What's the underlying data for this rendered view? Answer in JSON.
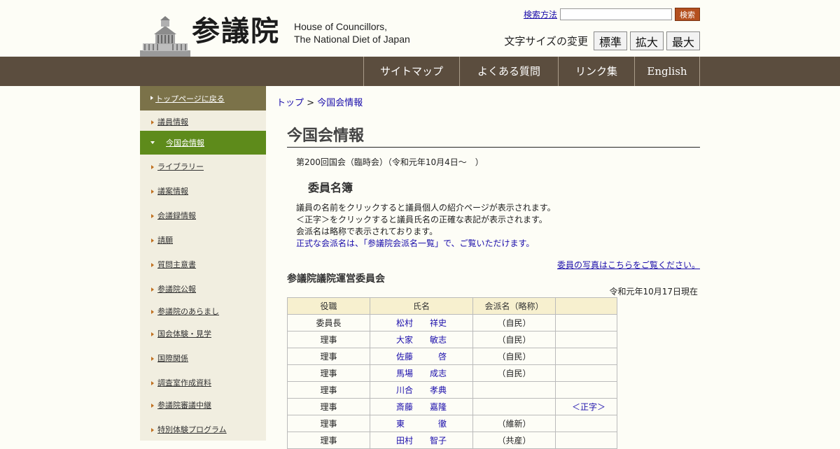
{
  "header": {
    "logo_kanji": "参議院",
    "logo_en_line1": "House of Councillors,",
    "logo_en_line2": "The National Diet of Japan",
    "search_link": "検索方法",
    "search_value": "",
    "search_button": "検索",
    "fontsize_label": "文字サイズの変更",
    "fontsize_buttons": [
      "標準",
      "拡大",
      "最大"
    ]
  },
  "nav": [
    "サイトマップ",
    "よくある質問",
    "リンク集",
    "English"
  ],
  "sidebar": {
    "top": "トップページに戻る",
    "items": [
      "議員情報",
      "今国会情報",
      "ライブラリー",
      "議案情報",
      "会議録情報",
      "請願",
      "質問主意書",
      "参議院公報",
      "参議院のあらまし",
      "国会体験・見学",
      "国際関係",
      "調査室作成資料",
      "参議院審議中継",
      "特別体験プログラム"
    ]
  },
  "breadcrumb": {
    "top": "トップ",
    "sep": " > ",
    "current": "今国会情報"
  },
  "page_title": "今国会情報",
  "session": "第200回国会（臨時会）（令和元年10月4日～　）",
  "subhead": "委員名簿",
  "notes": [
    "議員の名前をクリックすると議員個人の紹介ページが表示されます。",
    "＜正字＞をクリックすると議員氏名の正確な表記が表示されます。",
    "会派名は略称で表示されております。"
  ],
  "notes_link": "正式な会派名は、「参議院会派名一覧」で、ご覧いただけます。",
  "photo_link": "委員の写真はこちらをご覧ください。",
  "committee": "参議院議院運営委員会",
  "as_of": "令和元年10月17日現在",
  "table": {
    "headers": [
      "役職",
      "氏名",
      "会派名（略称）",
      ""
    ],
    "rows": [
      {
        "role": "委員長",
        "name": "松村　　祥史",
        "party": "（自民）",
        "seiji": ""
      },
      {
        "role": "理事",
        "name": "大家　　敏志",
        "party": "（自民）",
        "seiji": ""
      },
      {
        "role": "理事",
        "name": "佐藤　　　啓",
        "party": "（自民）",
        "seiji": ""
      },
      {
        "role": "理事",
        "name": "馬場　　成志",
        "party": "（自民）",
        "seiji": ""
      },
      {
        "role": "理事",
        "name": "川合　　孝典",
        "party": "",
        "seiji": ""
      },
      {
        "role": "理事",
        "name": "斎藤　　嘉隆",
        "party": "",
        "seiji": "＜正字＞"
      },
      {
        "role": "理事",
        "name": "東　　　　徹",
        "party": "（維新）",
        "seiji": ""
      },
      {
        "role": "理事",
        "name": "田村　　智子",
        "party": "（共産）",
        "seiji": ""
      }
    ]
  }
}
